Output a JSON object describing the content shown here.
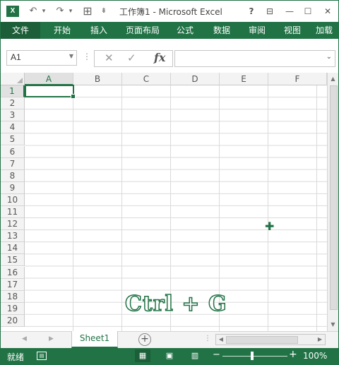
{
  "titlebar": {
    "app_icon_label": "X",
    "title": "工作簿1 - Microsoft Excel",
    "help": "?",
    "ribbon_display": "⊟",
    "minimize": "—",
    "maximize": "☐",
    "close": "✕",
    "undo": "↶",
    "redo": "↷",
    "dropdown": "▾",
    "table": "⊞",
    "customize": "⇟"
  },
  "ribbon": {
    "tabs": [
      "文件",
      "开始",
      "插入",
      "页面布局",
      "公式",
      "数据",
      "审阅",
      "视图",
      "加载"
    ]
  },
  "formula_bar": {
    "name_box": "A1",
    "name_dropdown": "▼",
    "separator": "⋮",
    "cancel": "✕",
    "enter": "✓",
    "fx": "fx",
    "formula_value": "",
    "expand": "⌄"
  },
  "grid": {
    "columns": [
      "A",
      "B",
      "C",
      "D",
      "E",
      "F"
    ],
    "rows": [
      "1",
      "2",
      "3",
      "4",
      "5",
      "6",
      "7",
      "8",
      "9",
      "10",
      "11",
      "12",
      "13",
      "14",
      "15",
      "16",
      "17",
      "18",
      "19",
      "20"
    ],
    "selected_cell": "A1"
  },
  "overlay": {
    "shortcut": "Ctrl + G"
  },
  "cursor": "✚",
  "sheets": {
    "nav_prev": "◀",
    "nav_next": "▶",
    "tabs": [
      "Sheet1"
    ],
    "add": "+",
    "dots": "⋮"
  },
  "hscroll": {
    "left": "◀",
    "right": "▶"
  },
  "vscroll": {
    "up": "▲",
    "down": "▼"
  },
  "status": {
    "ready": "就绪",
    "macro": "▤",
    "view_normal": "▦",
    "view_page_layout": "▣",
    "view_page_break": "▥",
    "zoom_minus": "−",
    "zoom_plus": "+",
    "zoom": "100%",
    "zoom_level": 100
  },
  "colors": {
    "accent": "#217346"
  }
}
